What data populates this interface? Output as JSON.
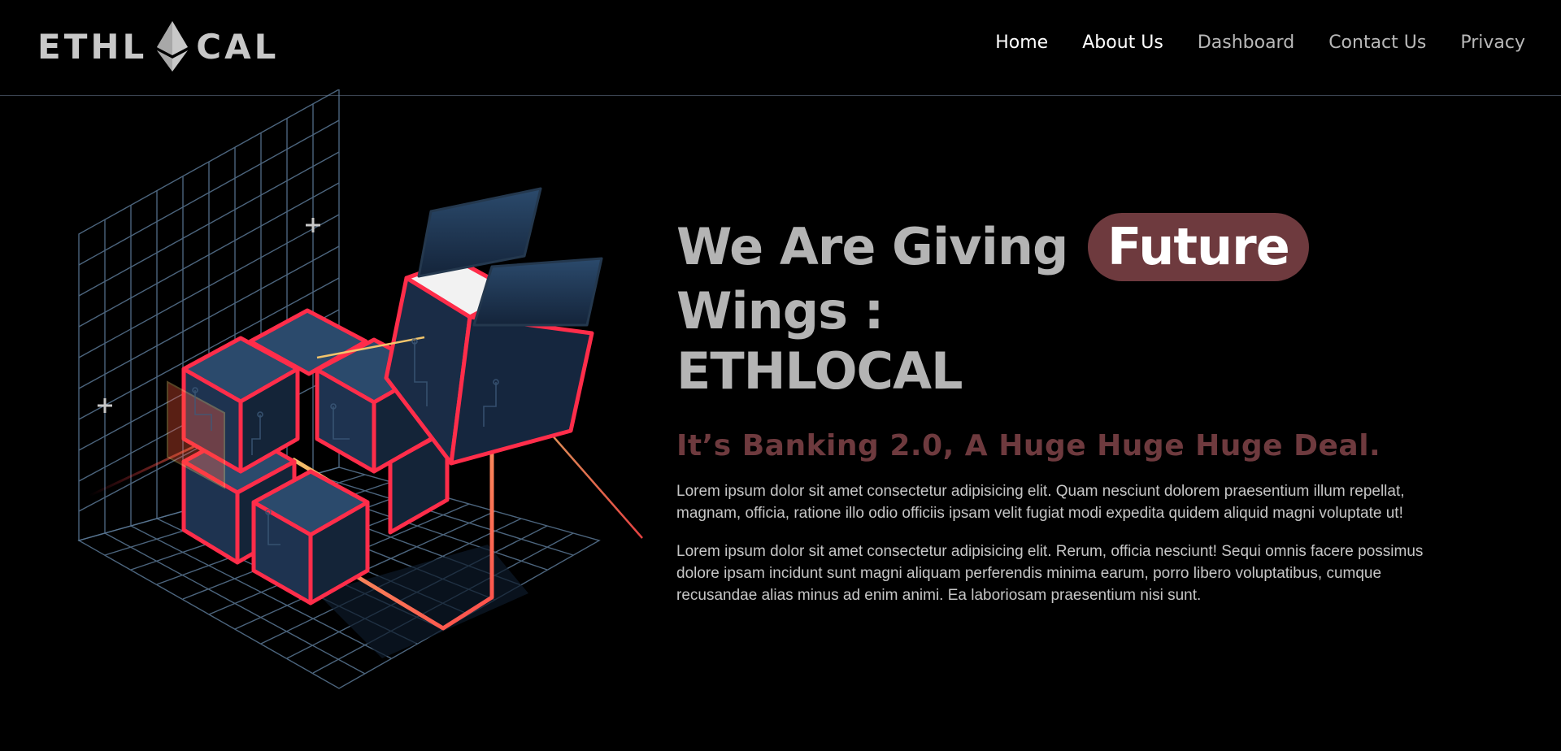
{
  "brand": {
    "logo_left": "ETHL",
    "logo_right": "CAL",
    "logo_icon": "ethereum-diamond-icon"
  },
  "nav": {
    "items": [
      {
        "label": "Home",
        "active": true
      },
      {
        "label": "About Us",
        "active": true
      },
      {
        "label": "Dashboard",
        "active": false
      },
      {
        "label": "Contact Us",
        "active": false
      },
      {
        "label": "Privacy",
        "active": false
      }
    ]
  },
  "hero": {
    "headline_before": "We Are Giving",
    "headline_highlight": "Future",
    "headline_after": "Wings :",
    "headline_line2": "ETHLOCAL",
    "subheading": "It’s Banking 2.0, A Huge Huge Huge Deal.",
    "paragraphs": [
      "Lorem ipsum dolor sit amet consectetur adipisicing elit. Quam nesciunt dolorem praesentium illum repellat, magnam, officia, ratione illo odio officiis ipsam velit fugiat modi expedita quidem aliquid magni voluptate ut!",
      "Lorem ipsum dolor sit amet consectetur adipisicing elit. Rerum, officia nesciunt! Sequi omnis facere possimus dolore ipsam incidunt sunt magni aliquam perferendis minima earum, porro libero voluptatibus, cumque recusandae alias minus ad enim animi. Ea laboriosam praesentium nisi sunt."
    ]
  },
  "colors": {
    "background": "#000000",
    "accent": "#6e3a3e",
    "cube_edge": "#ff2d4a",
    "grid": "#5a7794",
    "cube_face": "#1e3350"
  },
  "illustration": {
    "name": "isometric-cube-cluster-illustration"
  }
}
